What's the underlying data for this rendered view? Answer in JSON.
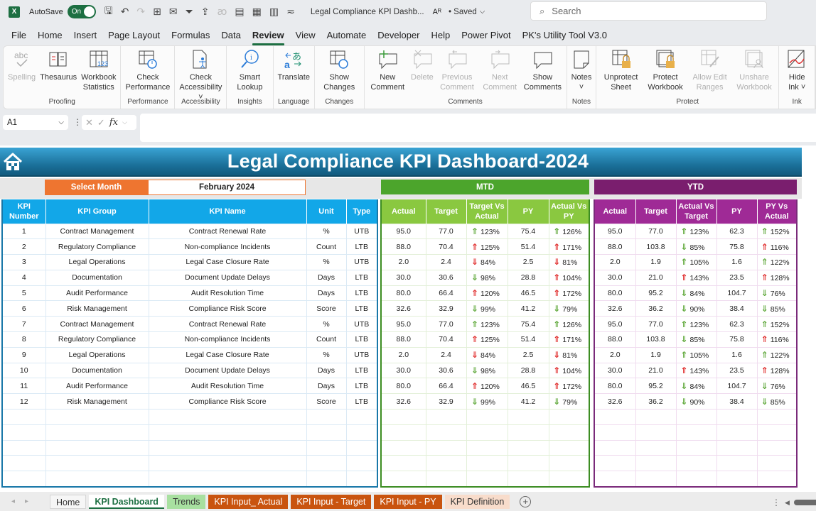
{
  "titlebar": {
    "app_icon": "X",
    "autosave_label": "AutoSave",
    "autosave_state": "On",
    "doc_title": "Legal Compliance KPI Dashb...",
    "saved_label": "• Saved",
    "search_placeholder": "Search"
  },
  "menu": {
    "tabs": [
      "File",
      "Home",
      "Insert",
      "Page Layout",
      "Formulas",
      "Data",
      "Review",
      "View",
      "Automate",
      "Developer",
      "Help",
      "Power Pivot",
      "PK's Utility Tool V3.0"
    ],
    "active": "Review"
  },
  "ribbon": {
    "groups": [
      {
        "label": "Proofing",
        "buttons": [
          {
            "label": "Spelling",
            "icon": "spelling-icon",
            "disabled": true
          },
          {
            "label": "Thesaurus",
            "icon": "thesaurus-icon",
            "disabled": false
          },
          {
            "label": "Workbook Statistics",
            "icon": "workbook-statistics-icon",
            "disabled": false
          }
        ]
      },
      {
        "label": "Performance",
        "buttons": [
          {
            "label": "Check Performance",
            "icon": "check-performance-icon",
            "disabled": false
          }
        ]
      },
      {
        "label": "Accessibility",
        "buttons": [
          {
            "label": "Check Accessibility ˅",
            "icon": "check-accessibility-icon",
            "disabled": false
          }
        ]
      },
      {
        "label": "Insights",
        "buttons": [
          {
            "label": "Smart Lookup",
            "icon": "smart-lookup-icon",
            "disabled": false
          }
        ]
      },
      {
        "label": "Language",
        "buttons": [
          {
            "label": "Translate",
            "icon": "translate-icon",
            "disabled": false
          }
        ]
      },
      {
        "label": "Changes",
        "buttons": [
          {
            "label": "Show Changes",
            "icon": "show-changes-icon",
            "disabled": false
          }
        ]
      },
      {
        "label": "Comments",
        "buttons": [
          {
            "label": "New Comment",
            "icon": "new-comment-icon",
            "disabled": false
          },
          {
            "label": "Delete",
            "icon": "delete-comment-icon",
            "disabled": true
          },
          {
            "label": "Previous Comment",
            "icon": "previous-comment-icon",
            "disabled": true
          },
          {
            "label": "Next Comment",
            "icon": "next-comment-icon",
            "disabled": true
          },
          {
            "label": "Show Comments",
            "icon": "show-comments-icon",
            "disabled": false
          }
        ]
      },
      {
        "label": "Notes",
        "buttons": [
          {
            "label": "Notes ˅",
            "icon": "notes-icon",
            "disabled": false
          }
        ]
      },
      {
        "label": "Protect",
        "buttons": [
          {
            "label": "Unprotect Sheet",
            "icon": "unprotect-sheet-icon",
            "disabled": false
          },
          {
            "label": "Protect Workbook",
            "icon": "protect-workbook-icon",
            "disabled": false
          },
          {
            "label": "Allow Edit Ranges",
            "icon": "allow-edit-ranges-icon",
            "disabled": true
          },
          {
            "label": "Unshare Workbook",
            "icon": "unshare-workbook-icon",
            "disabled": true
          }
        ]
      },
      {
        "label": "Ink",
        "buttons": [
          {
            "label": "Hide Ink ˅",
            "icon": "hide-ink-icon",
            "disabled": false
          }
        ]
      }
    ]
  },
  "formula_bar": {
    "name_box": "A1",
    "fx_label": "fx",
    "formula": ""
  },
  "dashboard": {
    "title": "Legal Compliance KPI Dashboard-2024",
    "select_month_label": "Select Month",
    "selected_month": "February 2024",
    "mtd_label": "MTD",
    "ytd_label": "YTD",
    "colors": {
      "orange": "#ee7530",
      "blue": "#12a7e8",
      "green": "#4ca52c",
      "purple": "#7a1e6e",
      "arrow_good": "#5fa83a",
      "arrow_bad": "#e02a2a"
    },
    "left_headers": [
      "KPI Number",
      "KPI Group",
      "KPI Name",
      "Unit",
      "Type"
    ],
    "mtd_headers": [
      "Actual",
      "Target",
      "Target Vs Actual",
      "PY",
      "Actual Vs PY"
    ],
    "ytd_headers": [
      "Actual",
      "Target",
      "Actual Vs Target",
      "PY",
      "PY Vs Actual"
    ],
    "rows": [
      {
        "num": "1",
        "group": "Contract Management",
        "name": "Contract Renewal Rate",
        "unit": "%",
        "type": "UTB",
        "mtd": {
          "actual": "95.0",
          "target": "77.0",
          "tva": "123%",
          "tva_dir": "up",
          "tva_good": true,
          "py": "75.4",
          "avp": "126%",
          "avp_dir": "up",
          "avp_good": true
        },
        "ytd": {
          "actual": "95.0",
          "target": "77.0",
          "avt": "123%",
          "avt_dir": "up",
          "avt_good": true,
          "py": "62.3",
          "pva": "152%",
          "pva_dir": "up",
          "pva_good": true
        }
      },
      {
        "num": "2",
        "group": "Regulatory Compliance",
        "name": "Non-compliance Incidents",
        "unit": "Count",
        "type": "LTB",
        "mtd": {
          "actual": "88.0",
          "target": "70.4",
          "tva": "125%",
          "tva_dir": "up",
          "tva_good": false,
          "py": "51.4",
          "avp": "171%",
          "avp_dir": "up",
          "avp_good": false
        },
        "ytd": {
          "actual": "88.0",
          "target": "103.8",
          "avt": "85%",
          "avt_dir": "down",
          "avt_good": true,
          "py": "75.8",
          "pva": "116%",
          "pva_dir": "up",
          "pva_good": false
        }
      },
      {
        "num": "3",
        "group": "Legal Operations",
        "name": "Legal Case Closure Rate",
        "unit": "%",
        "type": "UTB",
        "mtd": {
          "actual": "2.0",
          "target": "2.4",
          "tva": "84%",
          "tva_dir": "down",
          "tva_good": false,
          "py": "2.5",
          "avp": "81%",
          "avp_dir": "down",
          "avp_good": false
        },
        "ytd": {
          "actual": "2.0",
          "target": "1.9",
          "avt": "105%",
          "avt_dir": "up",
          "avt_good": true,
          "py": "1.6",
          "pva": "122%",
          "pva_dir": "up",
          "pva_good": true
        }
      },
      {
        "num": "4",
        "group": "Documentation",
        "name": "Document Update Delays",
        "unit": "Days",
        "type": "LTB",
        "mtd": {
          "actual": "30.0",
          "target": "30.6",
          "tva": "98%",
          "tva_dir": "down",
          "tva_good": true,
          "py": "28.8",
          "avp": "104%",
          "avp_dir": "up",
          "avp_good": false
        },
        "ytd": {
          "actual": "30.0",
          "target": "21.0",
          "avt": "143%",
          "avt_dir": "up",
          "avt_good": false,
          "py": "23.5",
          "pva": "128%",
          "pva_dir": "up",
          "pva_good": false
        }
      },
      {
        "num": "5",
        "group": "Audit Performance",
        "name": "Audit Resolution Time",
        "unit": "Days",
        "type": "LTB",
        "mtd": {
          "actual": "80.0",
          "target": "66.4",
          "tva": "120%",
          "tva_dir": "up",
          "tva_good": false,
          "py": "46.5",
          "avp": "172%",
          "avp_dir": "up",
          "avp_good": false
        },
        "ytd": {
          "actual": "80.0",
          "target": "95.2",
          "avt": "84%",
          "avt_dir": "down",
          "avt_good": true,
          "py": "104.7",
          "pva": "76%",
          "pva_dir": "down",
          "pva_good": true
        }
      },
      {
        "num": "6",
        "group": "Risk Management",
        "name": "Compliance Risk Score",
        "unit": "Score",
        "type": "LTB",
        "mtd": {
          "actual": "32.6",
          "target": "32.9",
          "tva": "99%",
          "tva_dir": "down",
          "tva_good": true,
          "py": "41.2",
          "avp": "79%",
          "avp_dir": "down",
          "avp_good": true
        },
        "ytd": {
          "actual": "32.6",
          "target": "36.2",
          "avt": "90%",
          "avt_dir": "down",
          "avt_good": true,
          "py": "38.4",
          "pva": "85%",
          "pva_dir": "down",
          "pva_good": true
        }
      },
      {
        "num": "7",
        "group": "Contract Management",
        "name": "Contract Renewal Rate",
        "unit": "%",
        "type": "UTB",
        "mtd": {
          "actual": "95.0",
          "target": "77.0",
          "tva": "123%",
          "tva_dir": "up",
          "tva_good": true,
          "py": "75.4",
          "avp": "126%",
          "avp_dir": "up",
          "avp_good": true
        },
        "ytd": {
          "actual": "95.0",
          "target": "77.0",
          "avt": "123%",
          "avt_dir": "up",
          "avt_good": true,
          "py": "62.3",
          "pva": "152%",
          "pva_dir": "up",
          "pva_good": true
        }
      },
      {
        "num": "8",
        "group": "Regulatory Compliance",
        "name": "Non-compliance Incidents",
        "unit": "Count",
        "type": "LTB",
        "mtd": {
          "actual": "88.0",
          "target": "70.4",
          "tva": "125%",
          "tva_dir": "up",
          "tva_good": false,
          "py": "51.4",
          "avp": "171%",
          "avp_dir": "up",
          "avp_good": false
        },
        "ytd": {
          "actual": "88.0",
          "target": "103.8",
          "avt": "85%",
          "avt_dir": "down",
          "avt_good": true,
          "py": "75.8",
          "pva": "116%",
          "pva_dir": "up",
          "pva_good": false
        }
      },
      {
        "num": "9",
        "group": "Legal Operations",
        "name": "Legal Case Closure Rate",
        "unit": "%",
        "type": "UTB",
        "mtd": {
          "actual": "2.0",
          "target": "2.4",
          "tva": "84%",
          "tva_dir": "down",
          "tva_good": false,
          "py": "2.5",
          "avp": "81%",
          "avp_dir": "down",
          "avp_good": false
        },
        "ytd": {
          "actual": "2.0",
          "target": "1.9",
          "avt": "105%",
          "avt_dir": "up",
          "avt_good": true,
          "py": "1.6",
          "pva": "122%",
          "pva_dir": "up",
          "pva_good": true
        }
      },
      {
        "num": "10",
        "group": "Documentation",
        "name": "Document Update Delays",
        "unit": "Days",
        "type": "LTB",
        "mtd": {
          "actual": "30.0",
          "target": "30.6",
          "tva": "98%",
          "tva_dir": "down",
          "tva_good": true,
          "py": "28.8",
          "avp": "104%",
          "avp_dir": "up",
          "avp_good": false
        },
        "ytd": {
          "actual": "30.0",
          "target": "21.0",
          "avt": "143%",
          "avt_dir": "up",
          "avt_good": false,
          "py": "23.5",
          "pva": "128%",
          "pva_dir": "up",
          "pva_good": false
        }
      },
      {
        "num": "11",
        "group": "Audit Performance",
        "name": "Audit Resolution Time",
        "unit": "Days",
        "type": "LTB",
        "mtd": {
          "actual": "80.0",
          "target": "66.4",
          "tva": "120%",
          "tva_dir": "up",
          "tva_good": false,
          "py": "46.5",
          "avp": "172%",
          "avp_dir": "up",
          "avp_good": false
        },
        "ytd": {
          "actual": "80.0",
          "target": "95.2",
          "avt": "84%",
          "avt_dir": "down",
          "avt_good": true,
          "py": "104.7",
          "pva": "76%",
          "pva_dir": "down",
          "pva_good": true
        }
      },
      {
        "num": "12",
        "group": "Risk Management",
        "name": "Compliance Risk Score",
        "unit": "Score",
        "type": "LTB",
        "mtd": {
          "actual": "32.6",
          "target": "32.9",
          "tva": "99%",
          "tva_dir": "down",
          "tva_good": true,
          "py": "41.2",
          "avp": "79%",
          "avp_dir": "down",
          "avp_good": true
        },
        "ytd": {
          "actual": "32.6",
          "target": "36.2",
          "avt": "90%",
          "avt_dir": "down",
          "avt_good": true,
          "py": "38.4",
          "pva": "85%",
          "pva_dir": "down",
          "pva_good": true
        }
      }
    ]
  },
  "sheet_tabs": [
    {
      "label": "Home",
      "style": "home"
    },
    {
      "label": "KPI Dashboard",
      "style": "active"
    },
    {
      "label": "Trends",
      "style": "green"
    },
    {
      "label": "KPI Input_ Actual",
      "style": "orange"
    },
    {
      "label": "KPI Input - Target",
      "style": "orange"
    },
    {
      "label": "KPI Input - PY",
      "style": "orange"
    },
    {
      "label": "KPI Definition",
      "style": "peach"
    }
  ]
}
